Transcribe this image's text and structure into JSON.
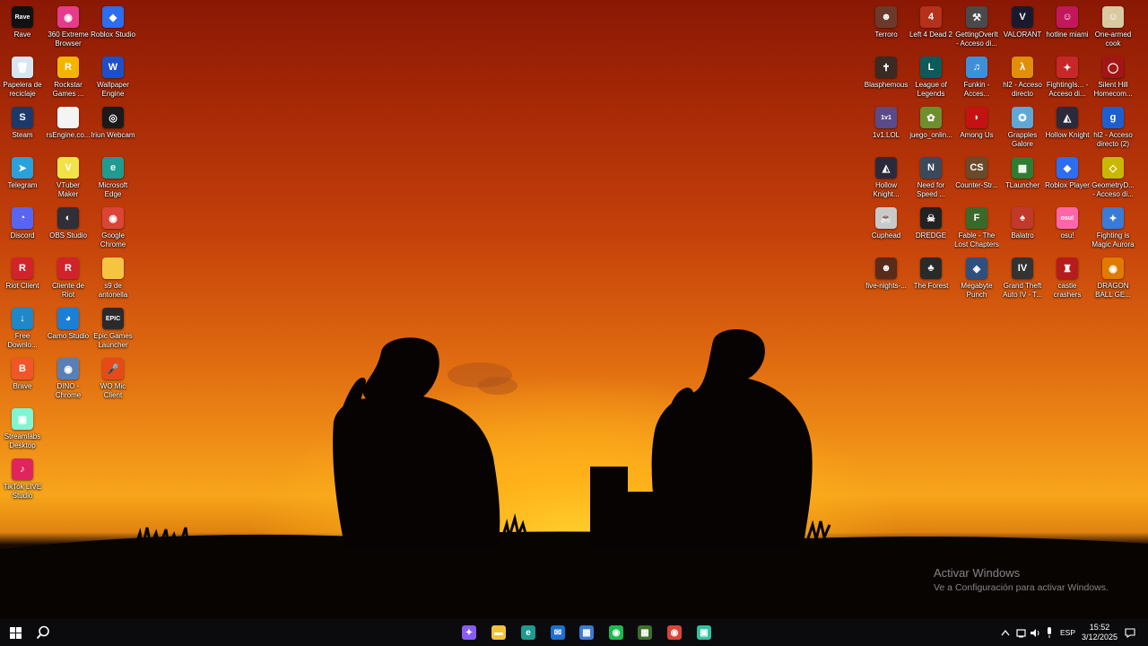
{
  "desktop": {
    "left_icons": [
      {
        "label": "Rave",
        "color": "#111111",
        "glyph": "Rave"
      },
      {
        "label": "360 Extreme Browser",
        "color": "#e63b8a",
        "glyph": "◉"
      },
      {
        "label": "Roblox Studio",
        "color": "#2b6ef0",
        "glyph": "◆"
      },
      {
        "label": "Papelera de reciclaje",
        "color": "#d9e4ee",
        "glyph": "🗑"
      },
      {
        "label": "Rockstar Games ...",
        "color": "#f5b300",
        "glyph": "R"
      },
      {
        "label": "Wallpaper Engine",
        "color": "#1f4fc4",
        "glyph": "W"
      },
      {
        "label": "Steam",
        "color": "#1b3a6b",
        "glyph": "S"
      },
      {
        "label": "rsEngine.co...",
        "color": "#f4f4f4",
        "glyph": ""
      },
      {
        "label": "Iriun Webcam",
        "color": "#1a1a1a",
        "glyph": "◎"
      },
      {
        "label": "Telegram",
        "color": "#2aa1da",
        "glyph": "➤"
      },
      {
        "label": "VTuber Maker",
        "color": "#f2e24a",
        "glyph": "V"
      },
      {
        "label": "Microsoft Edge",
        "color": "#1f9b8f",
        "glyph": "e"
      },
      {
        "label": "Discord",
        "color": "#5865f2",
        "glyph": "◔"
      },
      {
        "label": "OBS Studio",
        "color": "#302e36",
        "glyph": "◐"
      },
      {
        "label": "Google Chrome",
        "color": "#db4437",
        "glyph": "◉"
      },
      {
        "label": "Riot Client",
        "color": "#d2232a",
        "glyph": "R"
      },
      {
        "label": "Cliente de Riot",
        "color": "#d2232a",
        "glyph": "R"
      },
      {
        "label": "s9 de antonella",
        "color": "#f5c542",
        "glyph": ""
      },
      {
        "label": "Free Downlo...",
        "color": "#1e88c9",
        "glyph": "↓"
      },
      {
        "label": "Camo Studio",
        "color": "#1c7fd6",
        "glyph": "◕"
      },
      {
        "label": "Epic Games Launcher",
        "color": "#2a2a2a",
        "glyph": "EPIC"
      },
      {
        "label": "Brave",
        "color": "#f1562b",
        "glyph": "B"
      },
      {
        "label": "DINO - Chrome",
        "color": "#5a7fb6",
        "glyph": "◉"
      },
      {
        "label": "WO Mic Client",
        "color": "#e64a19",
        "glyph": "🎤"
      },
      {
        "label": "Streamlabs Desktop",
        "color": "#80f5d2",
        "glyph": "▣"
      },
      {
        "label": "TikTok LIVE Studio",
        "color": "#e0245e",
        "glyph": "♪"
      }
    ],
    "right_icons": [
      {
        "label": "Terroro",
        "color": "#6b3a2a",
        "glyph": "☻"
      },
      {
        "label": "Left 4 Dead 2",
        "color": "#b5311c",
        "glyph": "4"
      },
      {
        "label": "GettingOverIt - Acceso di...",
        "color": "#4a4a4a",
        "glyph": "⚒"
      },
      {
        "label": "VALORANT",
        "color": "#1a1a2e",
        "glyph": "V"
      },
      {
        "label": "hotline miami",
        "color": "#c2185b",
        "glyph": "☺"
      },
      {
        "label": "One-armed cook",
        "color": "#d9c9a0",
        "glyph": "☺"
      },
      {
        "label": "Blasphemous",
        "color": "#3a2a22",
        "glyph": "✝"
      },
      {
        "label": "League of Legends",
        "color": "#0e5a5a",
        "glyph": "L"
      },
      {
        "label": "Funkin - Acces...",
        "color": "#3f8fd8",
        "glyph": "♫"
      },
      {
        "label": "hl2 - Acceso directo",
        "color": "#e08e0b",
        "glyph": "λ"
      },
      {
        "label": "FightingIs... - Acceso di...",
        "color": "#c62828",
        "glyph": "✦"
      },
      {
        "label": "Silent Hill Homecom...",
        "color": "#a31515",
        "glyph": "◯"
      },
      {
        "label": "1v1.LOL",
        "color": "#5a4a8a",
        "glyph": "1v1"
      },
      {
        "label": "juego_onlin...",
        "color": "#6f8f2f",
        "glyph": "✿"
      },
      {
        "label": "Among Us",
        "color": "#c51111",
        "glyph": "◗"
      },
      {
        "label": "Grapples Galore",
        "color": "#5fa8d3",
        "glyph": "✪"
      },
      {
        "label": "Hollow Knight",
        "color": "#2a2a3a",
        "glyph": "◭"
      },
      {
        "label": "hl2 - Acceso directo (2)",
        "color": "#1e5fd0",
        "glyph": "g"
      },
      {
        "label": "Hollow Knight...",
        "color": "#2a2a3a",
        "glyph": "◭"
      },
      {
        "label": "Need for Speed ...",
        "color": "#3a4a5a",
        "glyph": "N"
      },
      {
        "label": "Counter-Str...",
        "color": "#6a4a2a",
        "glyph": "CS"
      },
      {
        "label": "TLauncher",
        "color": "#2e7d32",
        "glyph": "▦"
      },
      {
        "label": "Roblox Player",
        "color": "#2b6ef0",
        "glyph": "◆"
      },
      {
        "label": "GeometryD... - Acceso di...",
        "color": "#c9b800",
        "glyph": "◇"
      },
      {
        "label": "Cuphead",
        "color": "#c9c9c9",
        "glyph": "☕"
      },
      {
        "label": "DREDGE",
        "color": "#222222",
        "glyph": "☠"
      },
      {
        "label": "Fable - The Lost Chapters",
        "color": "#3a6a2a",
        "glyph": "F"
      },
      {
        "label": "Balatro",
        "color": "#c0392b",
        "glyph": "♠"
      },
      {
        "label": "osu!",
        "color": "#ff66aa",
        "glyph": "osu!"
      },
      {
        "label": "Fighting is Magic Aurora",
        "color": "#3a7bd5",
        "glyph": "✦"
      },
      {
        "label": "five-nights-...",
        "color": "#5a2a1a",
        "glyph": "☻"
      },
      {
        "label": "The Forest",
        "color": "#2a2a2a",
        "glyph": "♣"
      },
      {
        "label": "Megabyte Punch",
        "color": "#2f4f7f",
        "glyph": "◈"
      },
      {
        "label": "Grand Theft Auto IV - T...",
        "color": "#333333",
        "glyph": "IV"
      },
      {
        "label": "castle crashers",
        "color": "#b71c1c",
        "glyph": "♜"
      },
      {
        "label": "DRAGON BALL GE...",
        "color": "#e07b00",
        "glyph": "◉"
      }
    ]
  },
  "watermark": {
    "title": "Activar Windows",
    "subtitle": "Ve a Configuración para activar Windows."
  },
  "taskbar": {
    "pinned": [
      {
        "name": "copilot-icon",
        "color": "#8a5cf6",
        "glyph": "✦"
      },
      {
        "name": "file-explorer-icon",
        "color": "#f3c13a",
        "glyph": "▬"
      },
      {
        "name": "edge-icon",
        "color": "#1f9b8f",
        "glyph": "e"
      },
      {
        "name": "mail-icon",
        "color": "#1f6fd0",
        "glyph": "✉"
      },
      {
        "name": "store-icon",
        "color": "#3a7bd5",
        "glyph": "▦"
      },
      {
        "name": "spotify-icon",
        "color": "#1db954",
        "glyph": "◉"
      },
      {
        "name": "minecraft-icon",
        "color": "#3f6f2a",
        "glyph": "▦"
      },
      {
        "name": "chrome-icon",
        "color": "#db4437",
        "glyph": "◉"
      },
      {
        "name": "streamlabs-icon",
        "color": "#31c3a2",
        "glyph": "▣"
      }
    ],
    "language": "ESP",
    "time": "15:52",
    "date": "3/12/2025"
  }
}
